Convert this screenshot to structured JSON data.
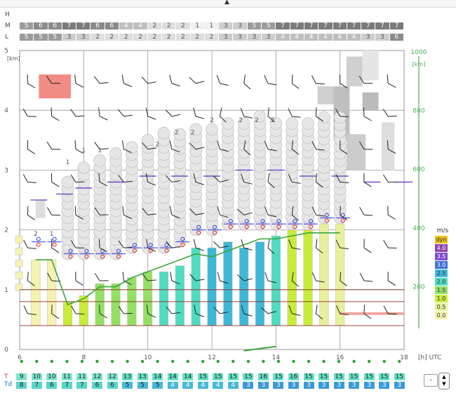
{
  "header": {
    "h_label": "H",
    "m_label": "M",
    "l_label": "L",
    "m_values": [
      "5",
      "6",
      "6",
      "7",
      "7",
      "6",
      "6",
      "4",
      "4",
      "2",
      "2",
      "2",
      "1",
      "1",
      "3",
      "3",
      "5",
      "5",
      "7",
      "7",
      "7",
      "7",
      "7",
      "7",
      "7",
      "7",
      "7"
    ],
    "l_values": [
      "5",
      "5",
      "5",
      "3",
      "3",
      "2",
      "2",
      "2",
      "2",
      "2",
      "2",
      "2",
      "2",
      "2",
      "3",
      "3",
      "3",
      "3",
      "4",
      "4",
      "4",
      "4",
      "4",
      "4",
      "3",
      "3",
      "6"
    ],
    "level_colors": {
      "1": "#efefef",
      "2": "#dedede",
      "3": "#cdcdcd",
      "4": "#bfbfbf",
      "5": "#9b9b9b",
      "6": "#8a8a8a",
      "7": "#7a7a7a"
    },
    "level_text_dark": [
      "1",
      "2",
      "3"
    ]
  },
  "chart_data": {
    "type": "meteogram",
    "xlabel": "[h] UTC",
    "x_ticks": [
      "6",
      "8",
      "10",
      "12",
      "14",
      "16",
      "18"
    ],
    "x_range": [
      6,
      18
    ],
    "left_axis": {
      "unit": "[km]",
      "ticks": [
        "0",
        "1",
        "2",
        "3",
        "4",
        "5"
      ],
      "range": [
        0,
        5
      ]
    },
    "right_axis": {
      "unit": "[km]",
      "ticks": [
        "200",
        "400",
        "600",
        "800",
        "1000"
      ],
      "range": [
        0,
        1000
      ],
      "color": "#4caf50"
    },
    "hours": [
      6.5,
      7.0,
      7.5,
      8.0,
      8.5,
      9.0,
      9.5,
      10.0,
      10.5,
      11.0,
      11.5,
      12.0,
      12.5,
      13.0,
      13.5,
      14.0,
      14.5,
      15.0,
      15.5,
      16.0
    ],
    "thermal_top_km": [
      1.5,
      1.5,
      2.9,
      3.1,
      3.2,
      3.4,
      3.5,
      3.6,
      3.7,
      3.7,
      3.8,
      3.8,
      3.9,
      3.9,
      4.0,
      3.9,
      3.9,
      3.9,
      3.9,
      3.9
    ],
    "cu_base_km": [
      null,
      null,
      1.6,
      1.6,
      1.6,
      1.6,
      1.7,
      1.7,
      1.7,
      1.8,
      2.0,
      2.0,
      2.1,
      2.1,
      2.1,
      2.1,
      2.1,
      2.1,
      2.2,
      2.2
    ],
    "bar_top_km": [
      1.5,
      1.5,
      0.8,
      0.9,
      1.1,
      1.1,
      1.2,
      1.3,
      1.3,
      1.4,
      1.7,
      1.7,
      1.8,
      1.7,
      1.8,
      1.9,
      2.0,
      2.0,
      2.1,
      2.1
    ],
    "bar_class": [
      "0.0",
      "0.0",
      "1.0",
      "1.0",
      "1.5",
      "1.5",
      "1.5",
      "1.5",
      "2.0",
      "2.0",
      "2.0",
      "2.5",
      "2.5",
      "2.5",
      "2.5",
      "2.0",
      "1.0",
      "1.0",
      "0.5",
      "0.5"
    ],
    "green_line_km": [
      1.5,
      1.5,
      0.75,
      0.85,
      1.05,
      1.05,
      1.2,
      1.3,
      1.4,
      1.5,
      1.6,
      1.55,
      1.65,
      1.75,
      1.85,
      1.85,
      1.9,
      1.95,
      1.95,
      1.95
    ],
    "cloud_digits": [
      {
        "hour": 8.0,
        "km": 3.3,
        "t": "1"
      },
      {
        "hour": 8.5,
        "km": 3.3,
        "t": "1"
      },
      {
        "hour": 7.5,
        "km": 3.1,
        "t": "1"
      },
      {
        "hour": 10.3,
        "km": 3.4,
        "t": "2"
      },
      {
        "hour": 10.9,
        "km": 3.6,
        "t": "2"
      },
      {
        "hour": 11.4,
        "km": 3.6,
        "t": "2"
      },
      {
        "hour": 12.0,
        "km": 3.8,
        "t": "2"
      },
      {
        "hour": 12.9,
        "km": 3.8,
        "t": "2"
      },
      {
        "hour": 13.4,
        "km": 3.8,
        "t": "2"
      },
      {
        "hour": 13.9,
        "km": 3.8,
        "t": "2"
      },
      {
        "hour": 6.5,
        "km": 1.9,
        "t": "2"
      },
      {
        "hour": 7.0,
        "km": 1.9,
        "t": "1"
      }
    ],
    "temps_T": [
      "9",
      "10",
      "10",
      "11",
      "11",
      "12",
      "12",
      "13",
      "13",
      "14",
      "14",
      "14",
      "15",
      "15",
      "15",
      "15",
      "16",
      "15",
      "16",
      "15",
      "15",
      "15",
      "15",
      "15",
      "15",
      "15"
    ],
    "temps_Td": [
      "8",
      "7",
      "6",
      "7",
      "7",
      "6",
      "6",
      "5",
      "5",
      "5",
      "4",
      "4",
      "4",
      "4",
      "4",
      "3",
      "3",
      "3",
      "3",
      "3",
      "3",
      "3",
      "3",
      "3",
      "3",
      "3"
    ],
    "T_label": "T",
    "Td_label": "Td"
  },
  "legend": {
    "title": "m/s",
    "rows": [
      {
        "label": "dyn",
        "color": "#e8c21a"
      },
      {
        "label": "4.0",
        "color": "#8e44ad"
      },
      {
        "label": "3.5",
        "color": "#7c4dd4"
      },
      {
        "label": "3.0",
        "color": "#3f6fd6"
      },
      {
        "label": "2.5",
        "color": "#3fb8d8"
      },
      {
        "label": "2.0",
        "color": "#4fdcc0"
      },
      {
        "label": "1.5",
        "color": "#93e064"
      },
      {
        "label": "1.0",
        "color": "#c9ec3a"
      },
      {
        "label": "0.5",
        "color": "#e8f09c"
      },
      {
        "label": "0.0",
        "color": "#f6f2b0"
      }
    ]
  },
  "controls": {
    "stepper_up": "▲",
    "stepper_down": "▼",
    "select_value": "-"
  }
}
